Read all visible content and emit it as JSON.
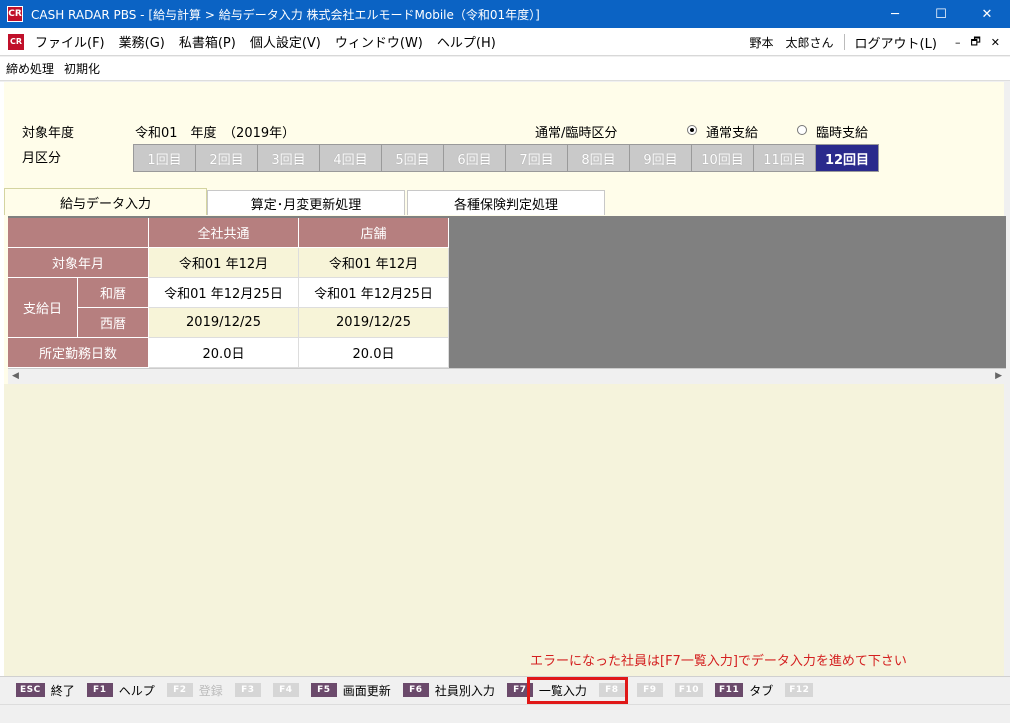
{
  "window": {
    "icon_text": "CR",
    "title": "CASH RADAR PBS - [給与計算 > 給与データ入力 株式会社エルモードMobile（令和01年度）]",
    "minimize": "─",
    "maximize": "☐",
    "close": "✕"
  },
  "menu": {
    "items": [
      "ファイル(F)",
      "業務(G)",
      "私書箱(P)",
      "個人設定(V)",
      "ウィンドウ(W)",
      "ヘルプ(H)"
    ],
    "user": "野本　太郎さん",
    "logout": "ログアウト(L)",
    "mdi_min": "–",
    "mdi_restore": "🗗",
    "mdi_close": "✕"
  },
  "subbar": {
    "items": [
      "締め処理",
      "初期化"
    ]
  },
  "header": {
    "year_label": "対象年度",
    "year_value": "令和01　年度　（2019年）",
    "month_label": "月区分",
    "type_label": "通常/臨時区分",
    "type_options": [
      {
        "label": "通常支給",
        "selected": true
      },
      {
        "label": "臨時支給",
        "selected": false
      }
    ],
    "months": [
      "1回目",
      "2回目",
      "3回目",
      "4回目",
      "5回目",
      "6回目",
      "7回目",
      "8回目",
      "9回目",
      "10回目",
      "11回目",
      "12回目"
    ],
    "active_month_index": 11
  },
  "tabs": [
    "給与データ入力",
    "算定･月変更新処理",
    "各種保険判定処理"
  ],
  "grid": {
    "col_headers": [
      "全社共通",
      "店舗"
    ],
    "rows": {
      "target_label": "対象年月",
      "target_values": [
        "令和01 年12月",
        "令和01 年12月"
      ],
      "payday_label": "支給日",
      "wareki_label": "和暦",
      "wareki_values": [
        "令和01 年12月25日",
        "令和01 年12月25日"
      ],
      "seireki_label": "西暦",
      "seireki_values": [
        "2019/12/25",
        "2019/12/25"
      ],
      "workdays_label": "所定勤務日数",
      "workdays_values": [
        "20.0日",
        "20.0日"
      ]
    }
  },
  "error_message": "エラーになった社員は[F7一覧入力]でデータ入力を進めて下さい",
  "fkeys": [
    {
      "key": "ESC",
      "label": "終了",
      "enabled": true
    },
    {
      "key": "F1",
      "label": "ヘルプ",
      "enabled": true
    },
    {
      "key": "F2",
      "label": "登録",
      "enabled": false
    },
    {
      "key": "F3",
      "label": "",
      "enabled": false
    },
    {
      "key": "F4",
      "label": "",
      "enabled": false
    },
    {
      "key": "F5",
      "label": "画面更新",
      "enabled": true
    },
    {
      "key": "F6",
      "label": "社員別入力",
      "enabled": true
    },
    {
      "key": "F7",
      "label": "一覧入力",
      "enabled": true
    },
    {
      "key": "F8",
      "label": "",
      "enabled": false
    },
    {
      "key": "F9",
      "label": "",
      "enabled": false
    },
    {
      "key": "F10",
      "label": "",
      "enabled": false
    },
    {
      "key": "F11",
      "label": "タブ",
      "enabled": true
    },
    {
      "key": "F12",
      "label": "",
      "enabled": false
    }
  ],
  "colors": {
    "titlebar": "#0b63c4",
    "grid_header": "#b67f7f",
    "active_month": "#2a2a8c",
    "error_text": "#d42020",
    "highlight": "#e01818"
  }
}
